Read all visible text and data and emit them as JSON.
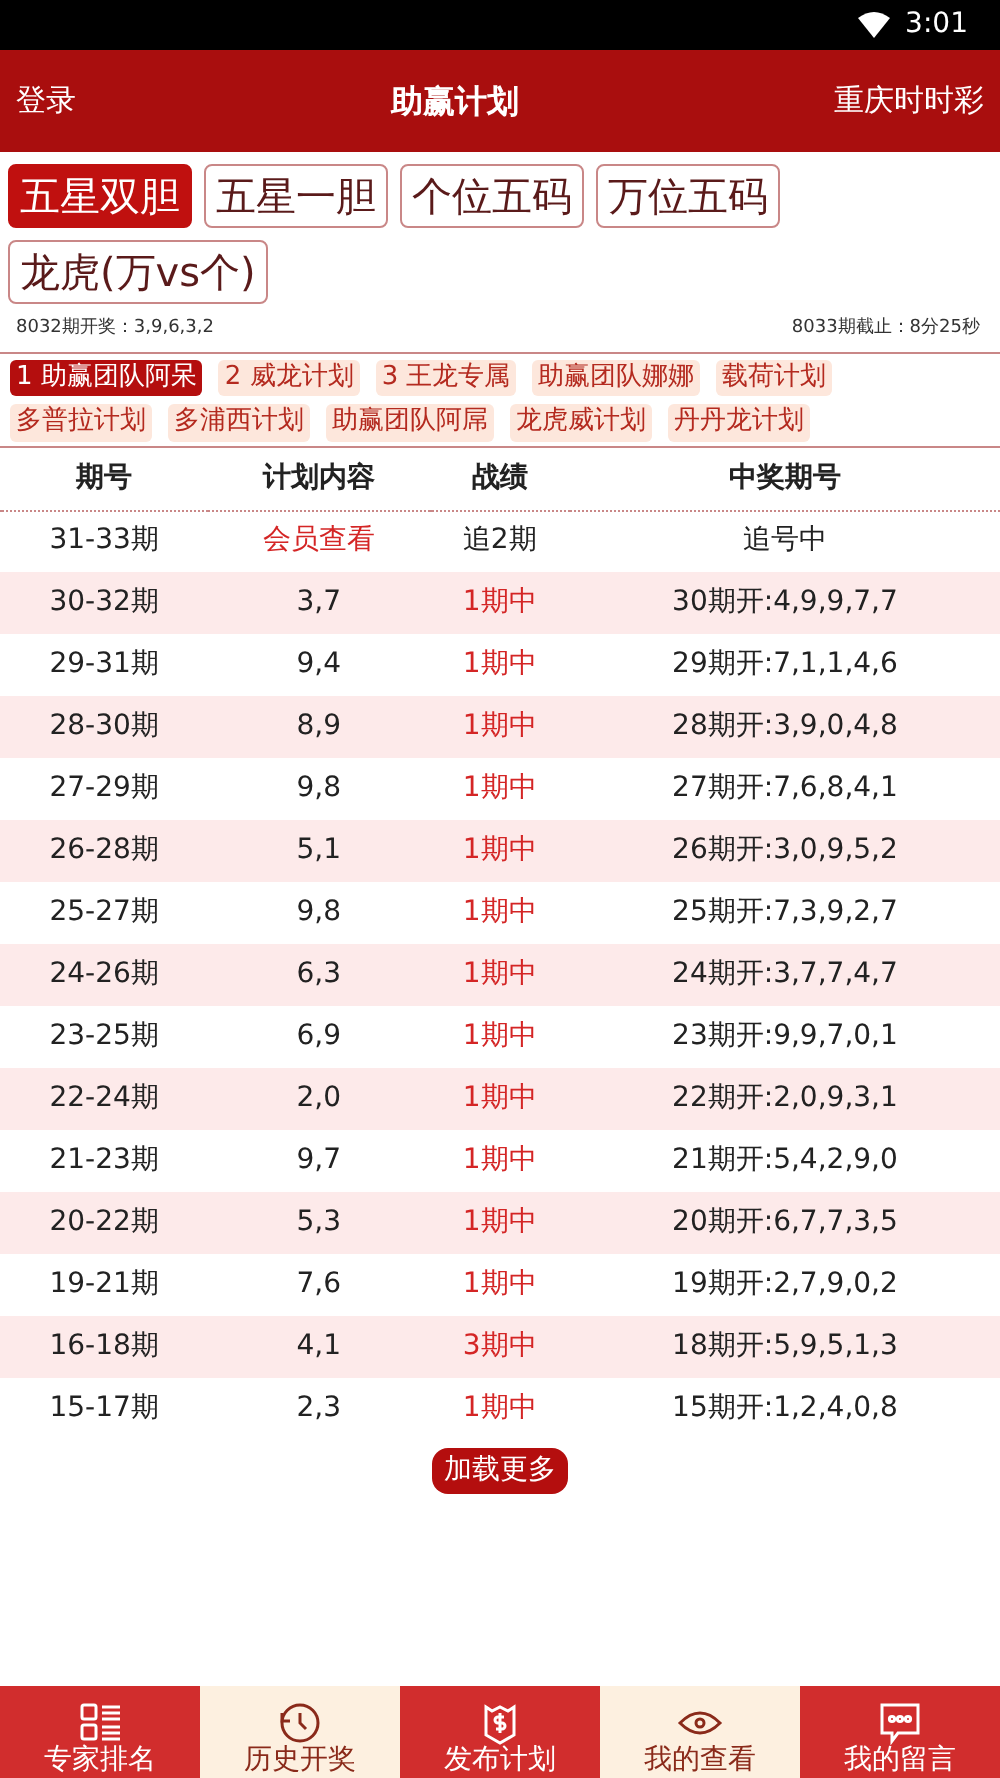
{
  "status_bar": {
    "time": "3:01"
  },
  "header": {
    "left": "登录",
    "title": "助赢计划",
    "right": "重庆时时彩"
  },
  "tabs": [
    {
      "label": "五星双胆",
      "selected": true
    },
    {
      "label": "五星一胆",
      "selected": false
    },
    {
      "label": "个位五码",
      "selected": false
    },
    {
      "label": "万位五码",
      "selected": false
    },
    {
      "label": "龙虎(万vs个)",
      "selected": false
    }
  ],
  "info": {
    "last_draw": "8032期开奖：3,9,6,3,2",
    "deadline": "8033期截止：8分25秒"
  },
  "plans": [
    {
      "label": "1 助赢团队阿呆",
      "selected": true
    },
    {
      "label": "2 威龙计划",
      "selected": false
    },
    {
      "label": "3 王龙专属",
      "selected": false
    },
    {
      "label": "助赢团队娜娜",
      "selected": false
    },
    {
      "label": "载荷计划",
      "selected": false
    },
    {
      "label": "多普拉计划",
      "selected": false
    },
    {
      "label": "多浦西计划",
      "selected": false
    },
    {
      "label": "助赢团队阿屌",
      "selected": false
    },
    {
      "label": "龙虎威计划",
      "selected": false
    },
    {
      "label": "丹丹龙计划",
      "selected": false
    }
  ],
  "table": {
    "columns": [
      "期号",
      "计划内容",
      "战绩",
      "中奖期号"
    ],
    "rows": [
      {
        "kind": "pending",
        "cells": [
          "31-33期",
          "会员查看",
          "追2期",
          "追号中"
        ]
      },
      {
        "kind": "hit",
        "cells": [
          "30-32期",
          "3,7",
          "1期中",
          "30期开:4,9,9,7,7"
        ]
      },
      {
        "kind": "hit",
        "cells": [
          "29-31期",
          "9,4",
          "1期中",
          "29期开:7,1,1,4,6"
        ]
      },
      {
        "kind": "hit",
        "cells": [
          "28-30期",
          "8,9",
          "1期中",
          "28期开:3,9,0,4,8"
        ]
      },
      {
        "kind": "hit",
        "cells": [
          "27-29期",
          "9,8",
          "1期中",
          "27期开:7,6,8,4,1"
        ]
      },
      {
        "kind": "hit",
        "cells": [
          "26-28期",
          "5,1",
          "1期中",
          "26期开:3,0,9,5,2"
        ]
      },
      {
        "kind": "hit",
        "cells": [
          "25-27期",
          "9,8",
          "1期中",
          "25期开:7,3,9,2,7"
        ]
      },
      {
        "kind": "hit",
        "cells": [
          "24-26期",
          "6,3",
          "1期中",
          "24期开:3,7,7,4,7"
        ]
      },
      {
        "kind": "hit",
        "cells": [
          "23-25期",
          "6,9",
          "1期中",
          "23期开:9,9,7,0,1"
        ]
      },
      {
        "kind": "hit",
        "cells": [
          "22-24期",
          "2,0",
          "1期中",
          "22期开:2,0,9,3,1"
        ]
      },
      {
        "kind": "hit",
        "cells": [
          "21-23期",
          "9,7",
          "1期中",
          "21期开:5,4,2,9,0"
        ]
      },
      {
        "kind": "hit",
        "cells": [
          "20-22期",
          "5,3",
          "1期中",
          "20期开:6,7,7,3,5"
        ]
      },
      {
        "kind": "hit",
        "cells": [
          "19-21期",
          "7,6",
          "1期中",
          "19期开:2,7,9,0,2"
        ]
      },
      {
        "kind": "hit",
        "cells": [
          "16-18期",
          "4,1",
          "3期中",
          "18期开:5,9,5,1,3"
        ]
      },
      {
        "kind": "hit",
        "cells": [
          "15-17期",
          "2,3",
          "1期中",
          "15期开:1,2,4,0,8"
        ]
      }
    ]
  },
  "load_more": "加载更多",
  "bottom_nav": [
    {
      "label": "专家排名",
      "kind": "list"
    },
    {
      "label": "历史开奖",
      "kind": "history"
    },
    {
      "label": "发布计划",
      "kind": "money"
    },
    {
      "label": "我的查看",
      "kind": "eye"
    },
    {
      "label": "我的留言",
      "kind": "chat"
    }
  ]
}
